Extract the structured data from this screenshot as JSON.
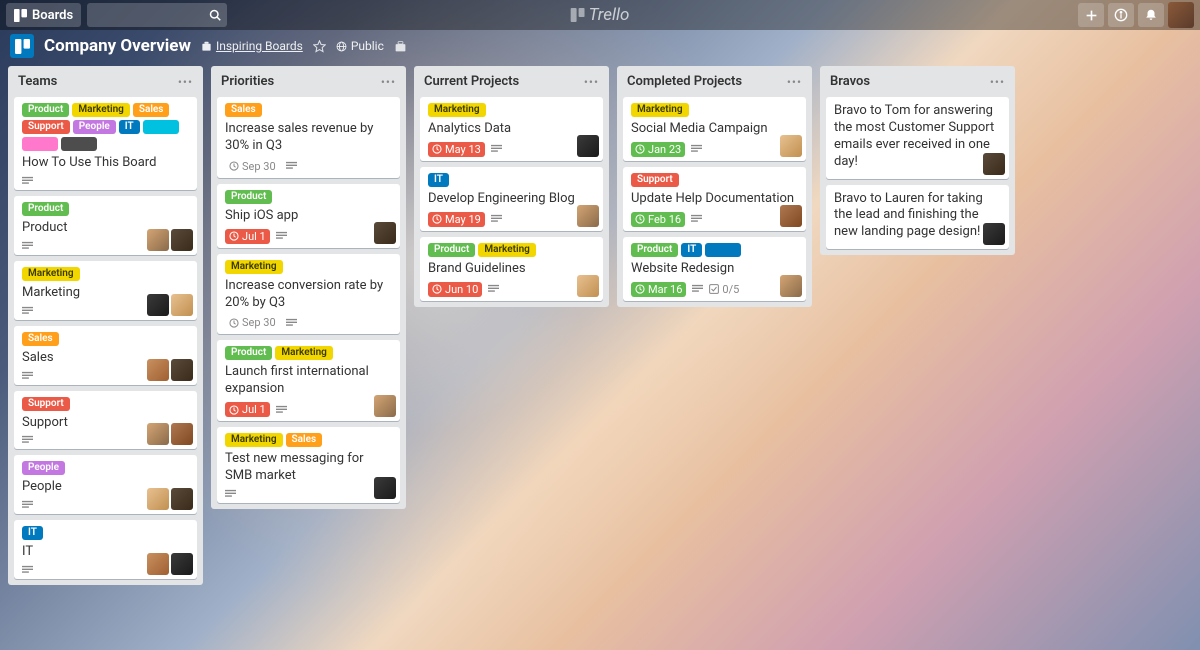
{
  "header": {
    "boards_label": "Boards",
    "logo_text": "Trello"
  },
  "board_header": {
    "title": "Company Overview",
    "inspiring": "Inspiring Boards",
    "visibility": "Public"
  },
  "label_colors": {
    "Product": "c-green",
    "Marketing": "c-yellow",
    "Sales": "c-orange",
    "Support": "c-red",
    "People": "c-purple",
    "IT": "c-blue"
  },
  "lists": [
    {
      "title": "Teams",
      "cards": [
        {
          "labels": [
            "Product",
            "Marketing",
            "Sales",
            "Support",
            "People",
            "IT"
          ],
          "extra_blank_labels": [
            "c-sky",
            "c-pink",
            "c-black"
          ],
          "title": "How To Use This Board",
          "desc": true
        },
        {
          "labels": [
            "Product"
          ],
          "title": "Product",
          "desc": true,
          "members": [
            "m1",
            "m2"
          ]
        },
        {
          "labels": [
            "Marketing"
          ],
          "title": "Marketing",
          "desc": true,
          "members": [
            "m5",
            "m4"
          ]
        },
        {
          "labels": [
            "Sales"
          ],
          "title": "Sales",
          "desc": true,
          "members": [
            "m3",
            "m2"
          ]
        },
        {
          "labels": [
            "Support"
          ],
          "title": "Support",
          "desc": true,
          "members": [
            "m1",
            "m6"
          ]
        },
        {
          "labels": [
            "People"
          ],
          "title": "People",
          "desc": true,
          "members": [
            "m4",
            "m2"
          ]
        },
        {
          "labels": [
            "IT"
          ],
          "title": "IT",
          "desc": true,
          "members": [
            "m3",
            "m5"
          ]
        }
      ]
    },
    {
      "title": "Priorities",
      "cards": [
        {
          "labels": [
            "Sales"
          ],
          "title": "Increase sales revenue by 30% in Q3",
          "due": "Sep 30",
          "due_style": "",
          "desc": true
        },
        {
          "labels": [
            "Product"
          ],
          "title": "Ship iOS app",
          "due": "Jul 1",
          "due_style": "due-red",
          "desc": true,
          "members": [
            "m2"
          ]
        },
        {
          "labels": [
            "Marketing"
          ],
          "title": "Increase conversion rate by 20% by Q3",
          "due": "Sep 30",
          "desc": true
        },
        {
          "labels": [
            "Product",
            "Marketing"
          ],
          "title": "Launch first international expansion",
          "due": "Jul 1",
          "due_style": "due-red",
          "desc": true,
          "members": [
            "m1"
          ]
        },
        {
          "labels": [
            "Marketing",
            "Sales"
          ],
          "title": "Test new messaging for SMB market",
          "desc": true,
          "members": [
            "m5"
          ]
        }
      ]
    },
    {
      "title": "Current Projects",
      "cards": [
        {
          "labels": [
            "Marketing"
          ],
          "title": "Analytics Data",
          "due": "May 13",
          "due_style": "due-red",
          "desc": true,
          "members": [
            "m5"
          ]
        },
        {
          "labels": [
            "IT"
          ],
          "title": "Develop Engineering Blog",
          "due": "May 19",
          "due_style": "due-red",
          "desc": true,
          "members": [
            "m1"
          ]
        },
        {
          "labels": [
            "Product",
            "Marketing"
          ],
          "title": "Brand Guidelines",
          "due": "Jun 10",
          "due_style": "due-red",
          "desc": true,
          "members": [
            "m4"
          ]
        }
      ]
    },
    {
      "title": "Completed Projects",
      "cards": [
        {
          "labels": [
            "Marketing"
          ],
          "title": "Social Media Campaign",
          "due": "Jan 23",
          "due_style": "due-green",
          "desc": true,
          "members": [
            "m4"
          ]
        },
        {
          "labels": [
            "Support"
          ],
          "title": "Update Help Documentation",
          "due": "Feb 16",
          "due_style": "due-green",
          "desc": true,
          "members": [
            "m6"
          ]
        },
        {
          "labels": [
            "Product",
            "IT"
          ],
          "extra_blank_labels": [
            "c-blue"
          ],
          "title": "Website Redesign",
          "due": "Mar 16",
          "due_style": "due-green",
          "desc": true,
          "checklist": "0/5",
          "members": [
            "m1"
          ]
        }
      ]
    },
    {
      "title": "Bravos",
      "cards": [
        {
          "title": "Bravo to Tom for answering the most Customer Support emails ever received in one day!",
          "members": [
            "m2"
          ]
        },
        {
          "title": "Bravo to Lauren for taking the lead and finishing the new landing page design!",
          "members": [
            "m5"
          ]
        }
      ]
    }
  ]
}
